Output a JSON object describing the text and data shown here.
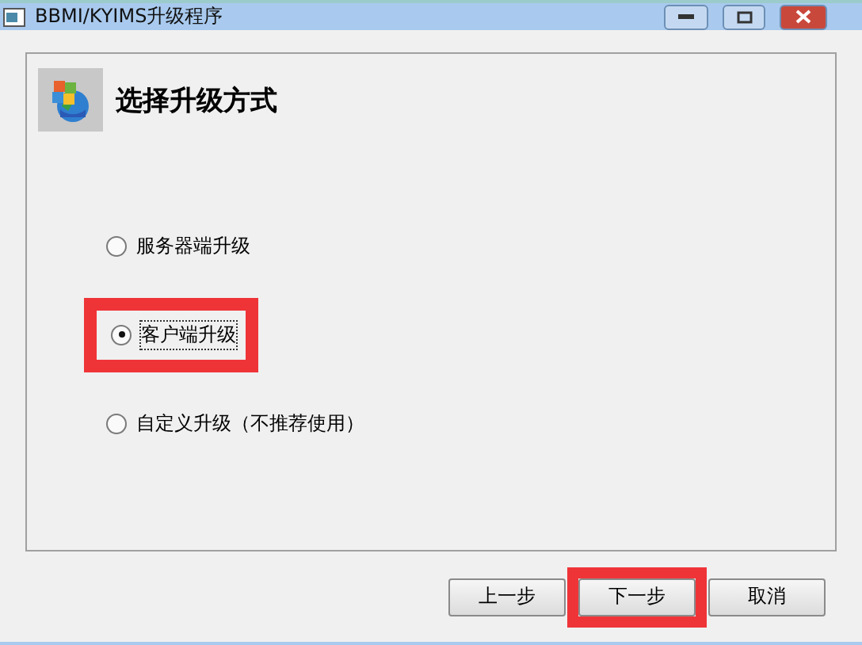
{
  "window": {
    "title": "BBMI/KYIMS升级程序"
  },
  "header": {
    "title": "选择升级方式"
  },
  "options": [
    {
      "label": "服务器端升级",
      "selected": false,
      "highlighted": false
    },
    {
      "label": "客户端升级",
      "selected": true,
      "highlighted": true
    },
    {
      "label": "自定义升级（不推荐使用）",
      "selected": false,
      "highlighted": false
    }
  ],
  "buttons": [
    {
      "label": "上一步",
      "highlighted": false
    },
    {
      "label": "下一步",
      "highlighted": true
    },
    {
      "label": "取消",
      "highlighted": false
    }
  ]
}
